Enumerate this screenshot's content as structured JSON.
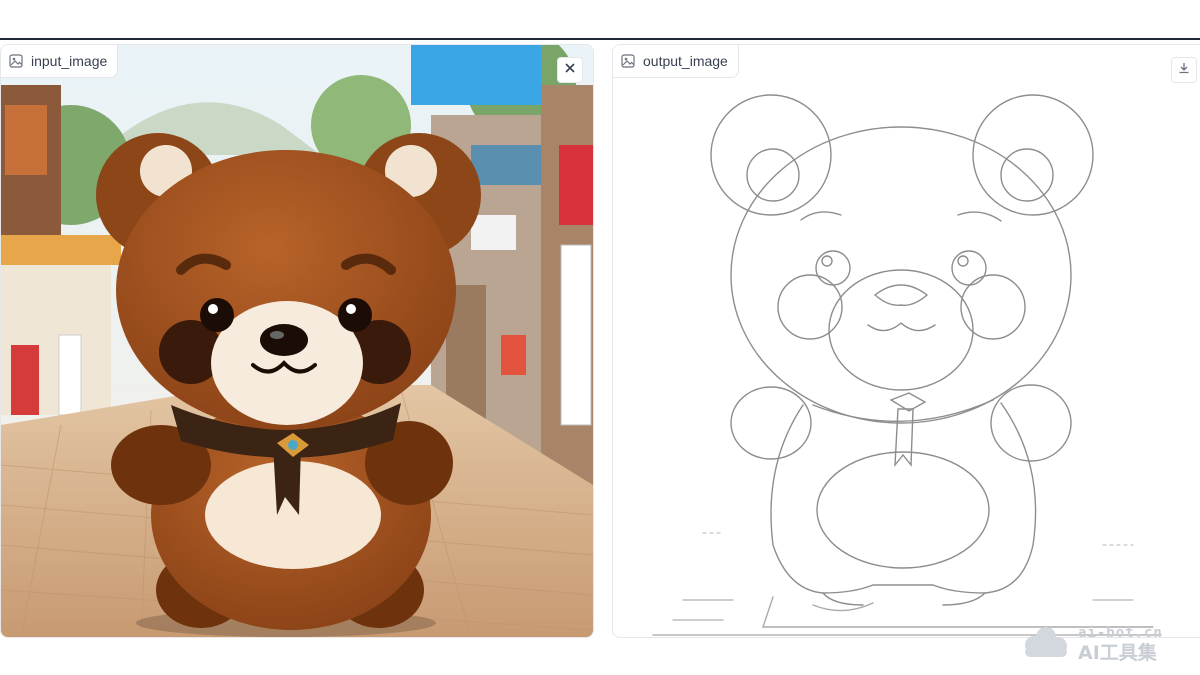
{
  "input_panel": {
    "label": "input_image",
    "close_icon": "close-icon",
    "label_icon": "image-icon"
  },
  "output_panel": {
    "label": "output_image",
    "download_icon": "download-icon",
    "label_icon": "image-icon"
  },
  "watermark": {
    "domain": "ai-bot.cn",
    "name": "AI工具集"
  },
  "colors": {
    "fur": "#9a4d18",
    "fur_dark": "#5e2a0c",
    "cream": "#f3e6d2",
    "sky": "#dcecf5",
    "floor": "#d8b08a",
    "sketch_line": "#8d8d8d"
  }
}
